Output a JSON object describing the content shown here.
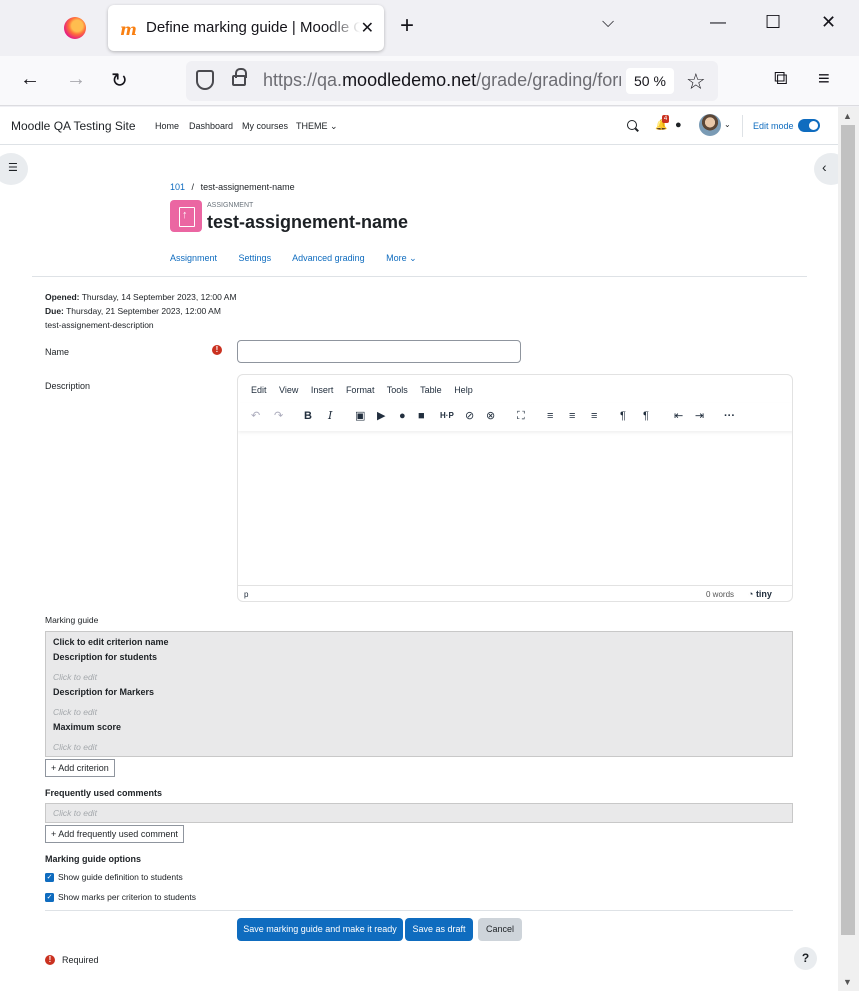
{
  "browser": {
    "tab_title": "Define marking guide | Moodle QA Testing Site",
    "url_prefix": "https://qa.",
    "url_domain": "moodledemo.net",
    "url_path": "/grade/grading/form/guide/edit.php",
    "zoom": "50 %"
  },
  "site": {
    "name": "Moodle QA Testing Site",
    "nav": [
      "Home",
      "Dashboard",
      "My courses",
      "THEME ⌄"
    ],
    "notification_count": "4",
    "edit_mode_label": "Edit mode"
  },
  "breadcrumb": {
    "course": "101",
    "separator": "/",
    "current": "test-assignement-name"
  },
  "activity": {
    "type": "ASSIGNMENT",
    "title": "test-assignement-name",
    "secondary_nav": [
      "Assignment",
      "Settings",
      "Advanced grading",
      "More ⌄"
    ]
  },
  "dates": {
    "opened_label": "Opened:",
    "opened_value": " Thursday, 14 September 2023, 12:00 AM",
    "due_label": "Due:",
    "due_value": " Thursday, 21 September 2023, 12:00 AM",
    "description": "test-assignement-description"
  },
  "form": {
    "name_label": "Name",
    "description_label": "Description",
    "required_icon": "!",
    "editor": {
      "menu": [
        "Edit",
        "View",
        "Insert",
        "Format",
        "Tools",
        "Table",
        "Help"
      ],
      "status_path": "p",
      "word_count": "0 words",
      "brand": "tiny"
    },
    "marking_guide_label": "Marking guide",
    "criterion": {
      "name": "Click to edit criterion name",
      "desc_students": "Description for students",
      "desc_students_hint": "Click to edit",
      "desc_markers": "Description for Markers",
      "desc_markers_hint": "Click to edit",
      "max_score": "Maximum score",
      "max_score_hint": "Click to edit"
    },
    "add_criterion": "+ Add criterion",
    "frequent_comments_label": "Frequently used comments",
    "frequent_comments_hint": "Click to edit",
    "add_frequent_comment": "+ Add frequently used comment",
    "options_label": "Marking guide options",
    "option_show_definition": "Show guide definition to students",
    "option_show_marks": "Show marks per criterion to students",
    "save_ready": "Save marking guide and make it ready",
    "save_draft": "Save as draft",
    "cancel": "Cancel",
    "required_text": "Required",
    "help": "?"
  }
}
